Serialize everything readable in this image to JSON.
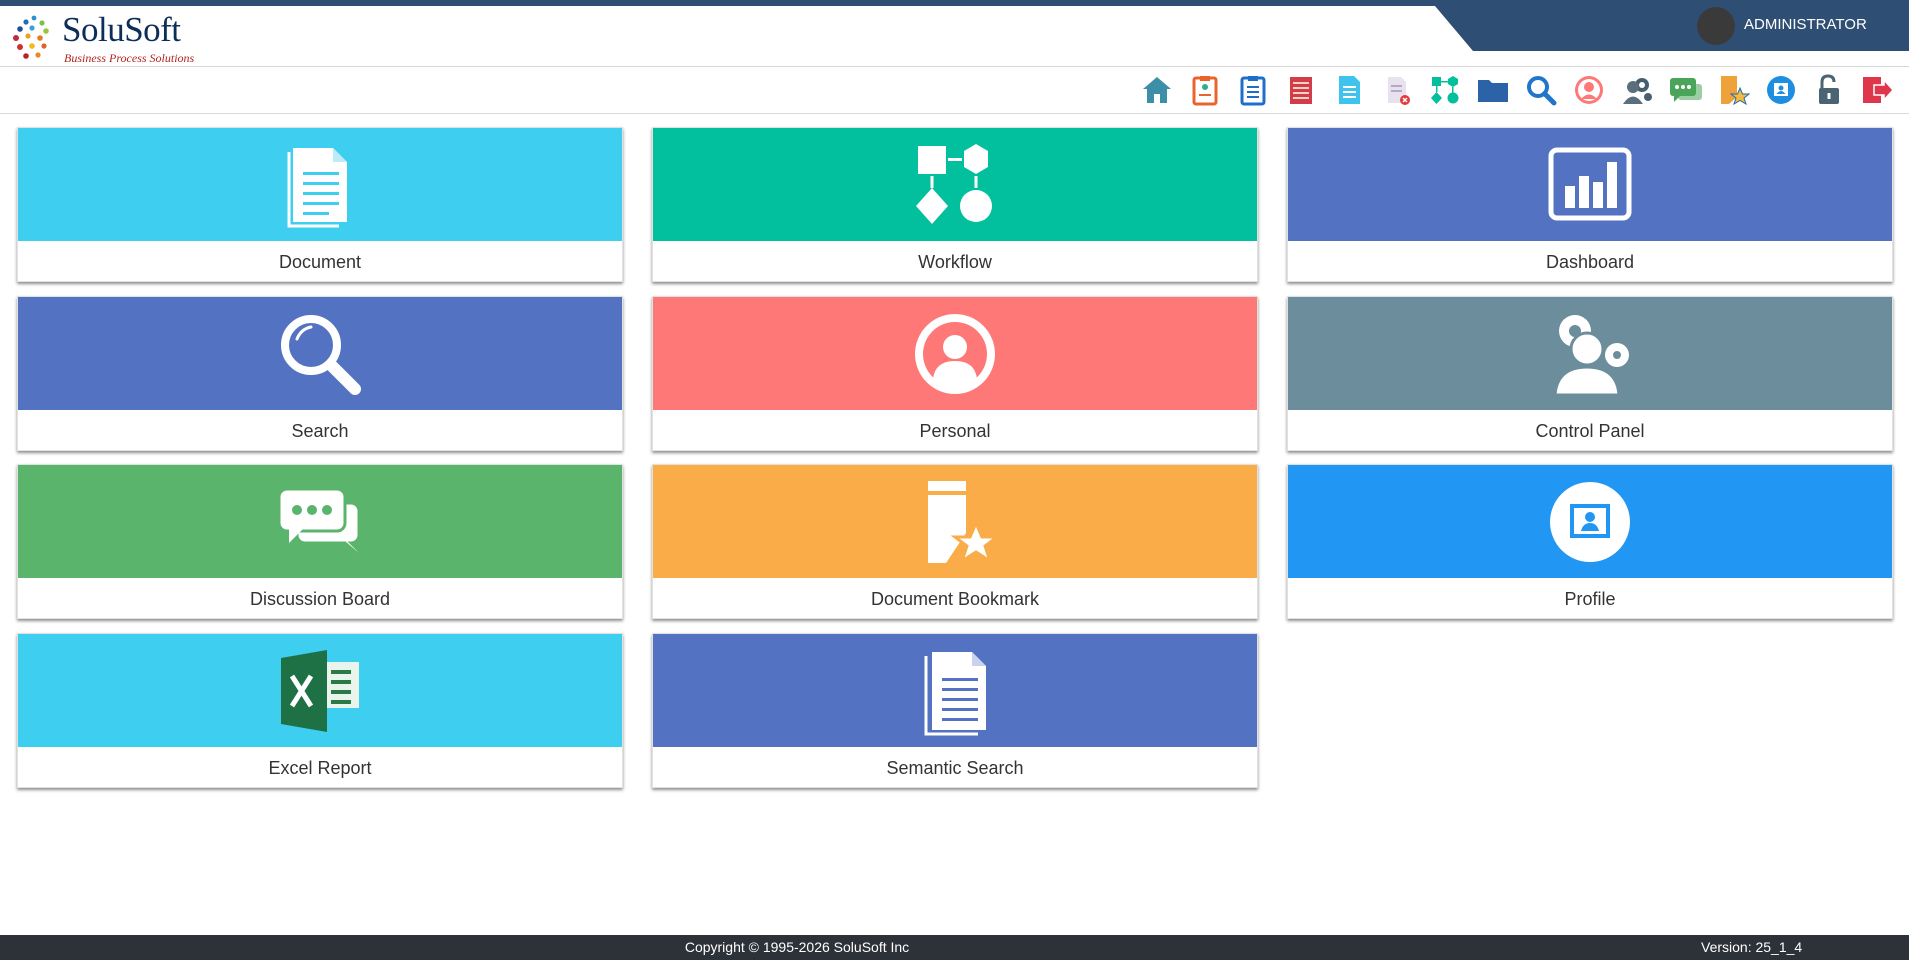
{
  "app": {
    "brand": "SoluSoft",
    "tagline": "Business Process Solutions",
    "user": "ADMINISTRATOR"
  },
  "colors": {
    "header_accent": "#2e4f73",
    "cyan": "#3ecff0",
    "teal": "#02bf9d",
    "indigo": "#5372c2",
    "coral": "#fe7878",
    "slate": "#6c8d9c",
    "green": "#5ab46c",
    "orange": "#f9ac48",
    "blue": "#2196f3"
  },
  "toolbar": {
    "icons": [
      "home-icon",
      "checklist-icon",
      "clipboard-icon",
      "ledger-icon",
      "document-icon",
      "delete-document-icon",
      "workflow-icon",
      "folder-icon",
      "search-icon",
      "personal-icon",
      "control-panel-icon",
      "discussion-icon",
      "bookmark-icon",
      "profile-icon",
      "unlock-icon",
      "logout-icon"
    ]
  },
  "tiles": [
    {
      "label": "Document",
      "icon": "document-icon",
      "color": "#3ecff0"
    },
    {
      "label": "Workflow",
      "icon": "workflow-icon",
      "color": "#02bf9d"
    },
    {
      "label": "Dashboard",
      "icon": "dashboard-icon",
      "color": "#5372c2"
    },
    {
      "label": "Search",
      "icon": "search-icon",
      "color": "#5372c2"
    },
    {
      "label": "Personal",
      "icon": "personal-icon",
      "color": "#fe7878"
    },
    {
      "label": "Control Panel",
      "icon": "control-panel-icon",
      "color": "#6c8d9c"
    },
    {
      "label": "Discussion Board",
      "icon": "discussion-icon",
      "color": "#5ab46c"
    },
    {
      "label": "Document Bookmark",
      "icon": "bookmark-icon",
      "color": "#f9ac48"
    },
    {
      "label": "Profile",
      "icon": "profile-icon",
      "color": "#2196f3"
    },
    {
      "label": "Excel Report",
      "icon": "excel-icon",
      "color": "#3ecff0"
    },
    {
      "label": "Semantic Search",
      "icon": "semantic-search-icon",
      "color": "#5372c2"
    }
  ],
  "footer": {
    "copyright": "Copyright © 1995-2026 SoluSoft Inc",
    "version": "Version: 25_1_4"
  }
}
